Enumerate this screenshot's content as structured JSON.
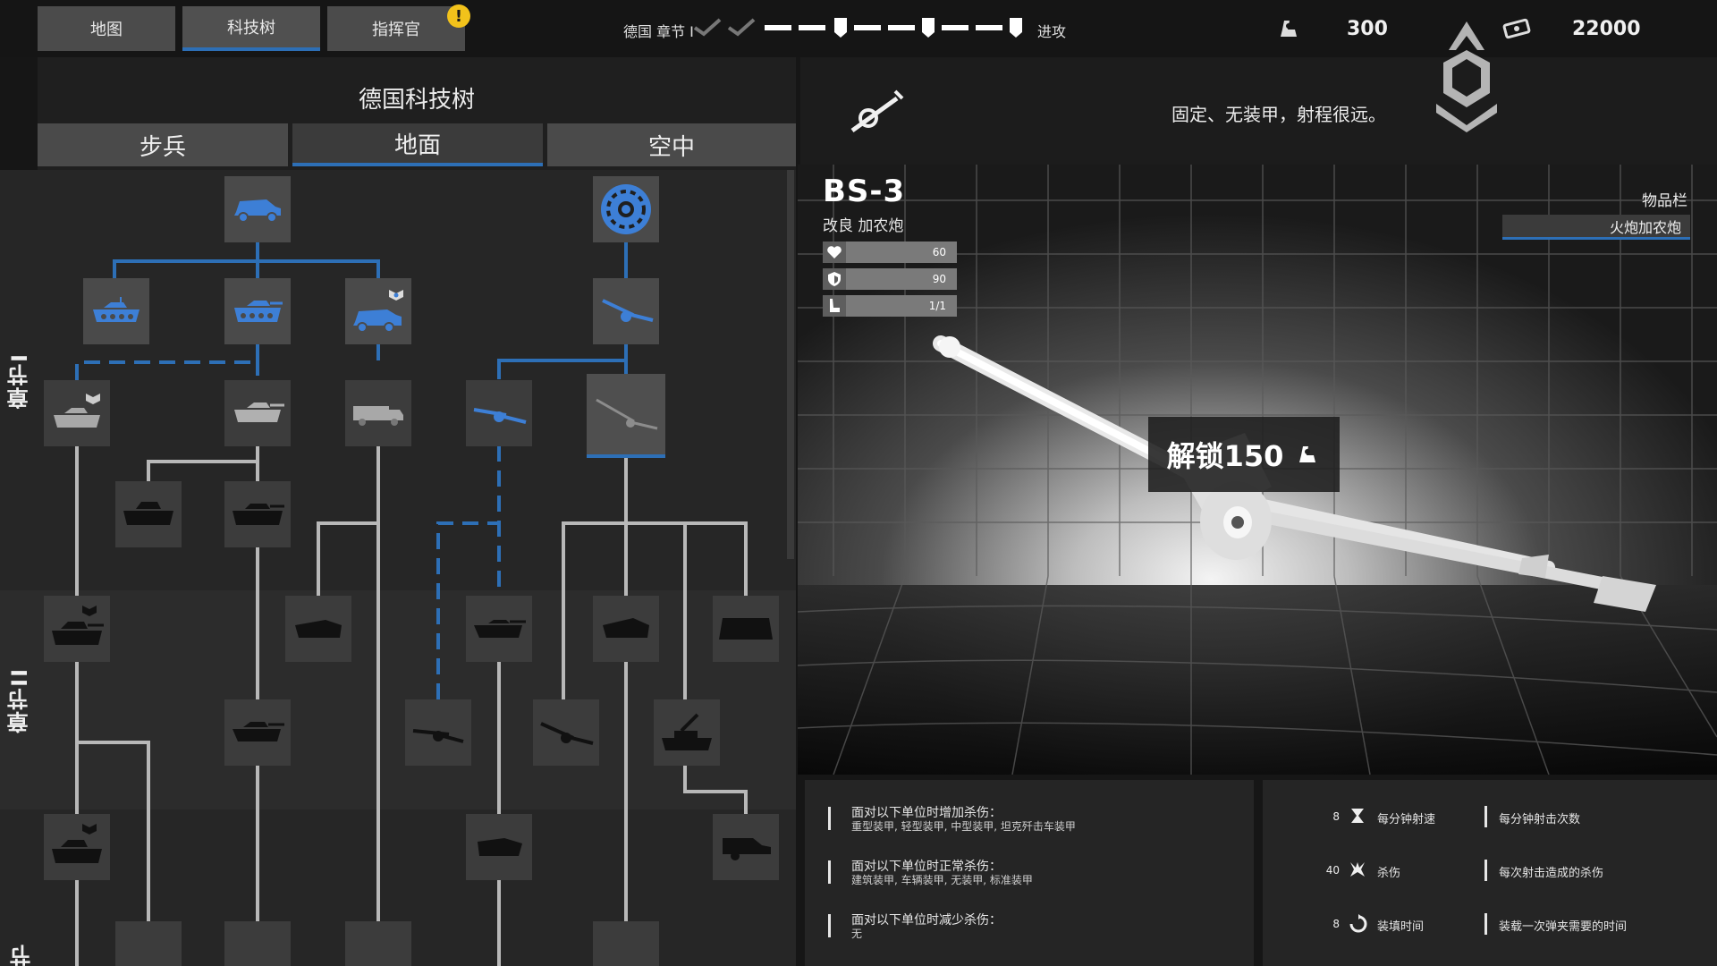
{
  "topbar": {
    "tabs": [
      {
        "label": "地图",
        "active": false
      },
      {
        "label": "科技树",
        "active": true
      },
      {
        "label": "指挥官",
        "active": false,
        "badge": "!"
      }
    ],
    "chapter_label": "德国 章节 I",
    "attack_label": "进攻",
    "resources": {
      "command_points": "300",
      "money": "22000"
    }
  },
  "tech_tree": {
    "title": "德国科技树",
    "subtabs": [
      {
        "label": "步兵",
        "active": false
      },
      {
        "label": "地面",
        "active": true
      },
      {
        "label": "空中",
        "active": false
      }
    ],
    "chapters": [
      "章节I",
      "章节II",
      "章节III"
    ]
  },
  "unit": {
    "description": "固定、无装甲，射程很远。",
    "name": "BS-3",
    "class": "改良 加农炮",
    "stats": {
      "health": "60",
      "armor": "90",
      "crew": "1/1"
    },
    "inventory_title": "物品栏",
    "inventory_item": "火炮加农炮",
    "unlock_label": "解锁150"
  },
  "damage": [
    {
      "title": "面对以下单位时增加杀伤：",
      "detail": "重型装甲, 轻型装甲, 中型装甲, 坦克歼击车装甲"
    },
    {
      "title": "面对以下单位时正常杀伤：",
      "detail": "建筑装甲, 车辆装甲, 无装甲, 标准装甲"
    },
    {
      "title": "面对以下单位时减少杀伤：",
      "detail": "无"
    }
  ],
  "specs": [
    {
      "value": "8",
      "icon": "hourglass-icon",
      "label": "每分钟射速",
      "desc": "每分钟射击次数"
    },
    {
      "value": "40",
      "icon": "explosion-icon",
      "label": "杀伤",
      "desc": "每次射击造成的杀伤"
    },
    {
      "value": "8",
      "icon": "reload-icon",
      "label": "装填时间",
      "desc": "装载一次弹夹需要的时间"
    }
  ],
  "colors": {
    "accent": "#2d6fb6",
    "unlocked": "#3d7fd6",
    "locked": "#bdbdbd",
    "badge": "#f2c21b"
  }
}
